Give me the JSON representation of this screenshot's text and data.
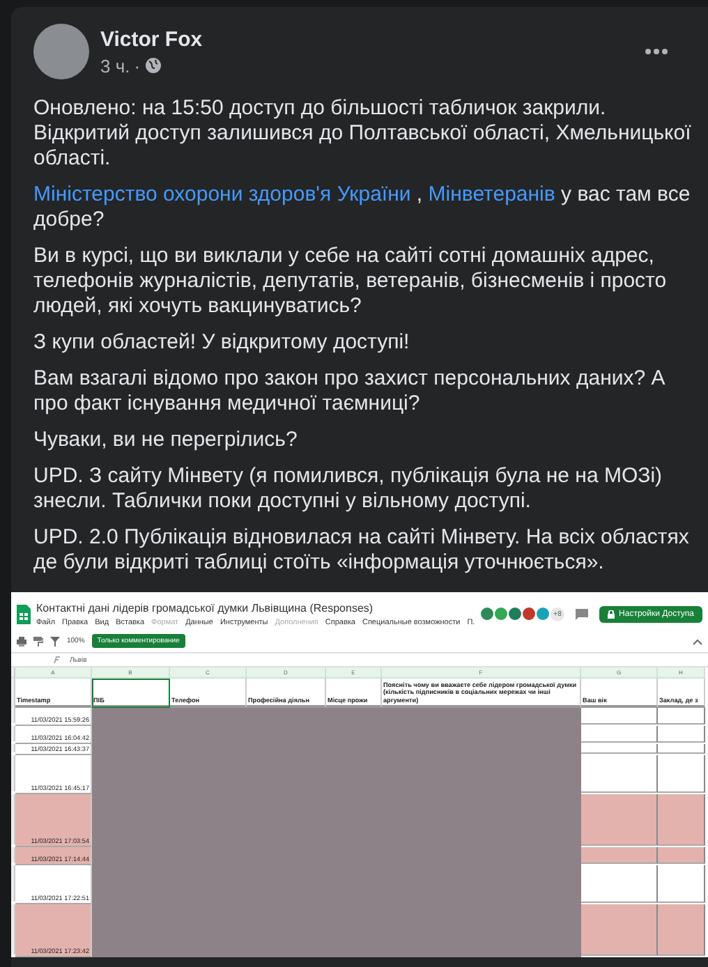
{
  "post": {
    "author": "Victor Fox",
    "time": "3 ч.",
    "separator": "·",
    "paragraphs": [
      {
        "parts": [
          {
            "kind": "text",
            "text": "Оновлено: на 15:50 доступ до більшості табличок закрили. Відкритий доступ залишився до Полтавської області, Хмельницької області."
          }
        ]
      },
      {
        "parts": [
          {
            "kind": "link",
            "text": "Міністерство охорони здоров'я України"
          },
          {
            "kind": "text",
            "text": " , "
          },
          {
            "kind": "link",
            "text": "Мінветеранів"
          },
          {
            "kind": "text",
            "text": " у вас там все добре?"
          }
        ]
      },
      {
        "parts": [
          {
            "kind": "text",
            "text": "Ви в курсі, що ви виклали у себе на сайті сотні домашніх адрес, телефонів журналістів, депутатів, ветеранів, бізнесменів і просто людей, які хочуть вакцинуватись?"
          }
        ]
      },
      {
        "parts": [
          {
            "kind": "text",
            "text": "З купи областей! У відкритому доступі!"
          }
        ]
      },
      {
        "parts": [
          {
            "kind": "text",
            "text": "Вам взагалі відомо про закон про захист персональних даних? А про факт існування медичної таємниці?"
          }
        ]
      },
      {
        "parts": [
          {
            "kind": "text",
            "text": "Чуваки, ви не перегрілись?"
          }
        ]
      },
      {
        "parts": [
          {
            "kind": "text",
            "text": "UPD. З сайту Мінвету (я помилився, публікація була не на МОЗі) знесли. Таблички поки доступні у вільному доступі."
          }
        ]
      },
      {
        "parts": [
          {
            "kind": "text",
            "text": "UPD. 2.0 Публікація відновилася на сайті Мінвету. На всіх областях де були відкриті таблиці стоїть «інформація уточнюється»."
          }
        ]
      }
    ],
    "sheet": {
      "title": "Контактні дані лідерів громадської думки Львівщина (Responses)",
      "menu": [
        {
          "text": "Файл",
          "disabled": false
        },
        {
          "text": "Правка",
          "disabled": false
        },
        {
          "text": "Вид",
          "disabled": false
        },
        {
          "text": "Вставка",
          "disabled": false
        },
        {
          "text": "Формат",
          "disabled": true
        },
        {
          "text": "Данные",
          "disabled": false
        },
        {
          "text": "Инструменты",
          "disabled": false
        },
        {
          "text": "Дополнения",
          "disabled": true
        },
        {
          "text": "Справка",
          "disabled": false
        },
        {
          "text": "Специальные возможности",
          "disabled": false
        },
        {
          "text": "П.",
          "disabled": false
        }
      ],
      "collaborators": [
        {
          "color": "#2e8b57"
        },
        {
          "color": "#34a853"
        },
        {
          "color": "#1e7e5a"
        },
        {
          "color": "#c0392b"
        },
        {
          "color": "#1aa3b8"
        }
      ],
      "more_collaborators": "+8",
      "share_button": "Настройки Доступа",
      "zoom": "100%",
      "mode_button": "Только комментирование",
      "formula": "Львів",
      "column_letters": [
        "A",
        "B",
        "C",
        "D",
        "E",
        "F",
        "G",
        "H"
      ],
      "headers": [
        {
          "text": "Timestamp",
          "selected": false
        },
        {
          "text": "ПІБ",
          "selected": true
        },
        {
          "text": "Телефон",
          "selected": false
        },
        {
          "text": "Професійна діяльн",
          "selected": false
        },
        {
          "text": "Місце прожи",
          "selected": false
        },
        {
          "text": "Поясніть чому ви вважаєте себе лідером громадської думки (кількість підписників в соціальних мережах чи інші аргументи)",
          "selected": false
        },
        {
          "text": "Ваш вік",
          "selected": false
        },
        {
          "text": "Заклад, де з",
          "selected": false
        }
      ],
      "rows": [
        {
          "timestamp": "11/03/2021 15:59:26",
          "kind": "short",
          "highlighted": false
        },
        {
          "timestamp": "11/03/2021 16:04:42",
          "kind": "short",
          "highlighted": false
        },
        {
          "timestamp": "11/03/2021 16:43:37",
          "kind": "compact",
          "highlighted": false
        },
        {
          "timestamp": "11/03/2021 16:45:17",
          "kind": "medium",
          "highlighted": false
        },
        {
          "timestamp": "11/03/2021 17:03:54",
          "kind": "tall",
          "highlighted": true
        },
        {
          "timestamp": "11/03/2021 17:14:44",
          "kind": "short",
          "highlighted": true
        },
        {
          "timestamp": "11/03/2021 17:22:51",
          "kind": "medium",
          "highlighted": false
        },
        {
          "timestamp": "11/03/2021 17:23:42",
          "kind": "tall",
          "highlighted": true
        }
      ]
    }
  }
}
